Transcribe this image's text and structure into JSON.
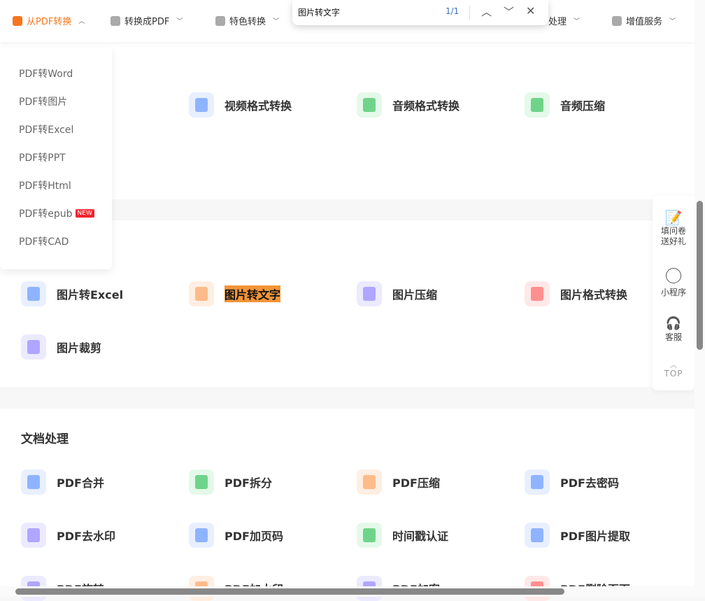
{
  "nav": [
    {
      "label": "从PDF转换",
      "icon": "pdf-from-icon",
      "active": true
    },
    {
      "label": "转换成PDF",
      "icon": "pdf-to-icon"
    },
    {
      "label": "特色转换",
      "icon": "shield-star-icon"
    },
    {
      "label": "处理",
      "icon": "process-icon"
    },
    {
      "label": "增值服务",
      "icon": "list-icon"
    }
  ],
  "find": {
    "query": "图片转文字",
    "count": "1/1"
  },
  "dropdown": [
    {
      "label": "PDF转Word"
    },
    {
      "label": "PDF转图片"
    },
    {
      "label": "PDF转Excel"
    },
    {
      "label": "PDF转PPT"
    },
    {
      "label": "PDF转Html"
    },
    {
      "label": "PDF转epub",
      "badge": "NEW"
    },
    {
      "label": "PDF转CAD"
    }
  ],
  "media": [
    {
      "label": "视频格式转换",
      "color": "#8fb4ff",
      "bg": "#e8efff"
    },
    {
      "label": "音频格式转换",
      "color": "#6fd48a",
      "bg": "#e4f9ea"
    },
    {
      "label": "音频压缩",
      "color": "#6fd48a",
      "bg": "#e4f9ea"
    }
  ],
  "image": [
    {
      "label": "图片转Excel",
      "color": "#8fb4ff",
      "bg": "#e8efff"
    },
    {
      "label": "图片转文字",
      "color": "#ffbb8a",
      "bg": "#ffeee2",
      "highlight": true
    },
    {
      "label": "图片压缩",
      "color": "#b0a6ff",
      "bg": "#eceaff"
    },
    {
      "label": "图片格式转换",
      "color": "#ff8f8f",
      "bg": "#ffe8e8"
    },
    {
      "label": "图片裁剪",
      "color": "#b0a6ff",
      "bg": "#eceaff"
    }
  ],
  "docs": {
    "title": "文档处理",
    "items": [
      {
        "label": "PDF合并",
        "color": "#8fb4ff",
        "bg": "#e8efff"
      },
      {
        "label": "PDF拆分",
        "color": "#6fd48a",
        "bg": "#e4f9ea"
      },
      {
        "label": "PDF压缩",
        "color": "#ffbb8a",
        "bg": "#ffeee2"
      },
      {
        "label": "PDF去密码",
        "color": "#8fb4ff",
        "bg": "#e8efff"
      },
      {
        "label": "PDF去水印",
        "color": "#b0a6ff",
        "bg": "#eceaff"
      },
      {
        "label": "PDF加页码",
        "color": "#8fb4ff",
        "bg": "#e8efff"
      },
      {
        "label": "时间戳认证",
        "color": "#6fd48a",
        "bg": "#e4f9ea"
      },
      {
        "label": "PDF图片提取",
        "color": "#8fb4ff",
        "bg": "#e8efff"
      },
      {
        "label": "PDF旋转",
        "color": "#b0a6ff",
        "bg": "#eceaff"
      },
      {
        "label": "PDF加水印",
        "color": "#ffbb8a",
        "bg": "#ffeee2"
      },
      {
        "label": "PDF加密",
        "color": "#b0a6ff",
        "bg": "#eceaff"
      },
      {
        "label": "PDF删除页面",
        "color": "#ff8f8f",
        "bg": "#ffe8e8"
      }
    ]
  },
  "side": [
    {
      "label": "填问卷送好礼",
      "icon": "survey-icon"
    },
    {
      "label": "小程序",
      "icon": "mini-program-icon"
    },
    {
      "label": "客服",
      "icon": "headset-icon"
    },
    {
      "label": "TOP",
      "icon": "chevron-up-icon"
    }
  ]
}
